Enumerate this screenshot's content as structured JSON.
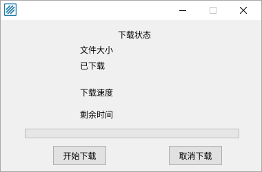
{
  "window": {
    "app_icon": "app-icon",
    "title": ""
  },
  "titlebar_controls": {
    "minimize_icon": "minimize-icon",
    "maximize_icon": "maximize-icon",
    "close_icon": "close-icon"
  },
  "panel": {
    "title": "下载状态",
    "file_size_label": "文件大小",
    "downloaded_label": "已下载",
    "speed_label": "下载速度",
    "remaining_time_label": "剩余时间"
  },
  "progress": {
    "fraction": 0,
    "fill_color": "#06b025"
  },
  "buttons": {
    "start_label": "开始下载",
    "cancel_label": "取消下载"
  },
  "colors": {
    "window_bg": "#f0f0f0",
    "titlebar_bg": "#ffffff",
    "icon_accent": "#1e7ba8"
  }
}
